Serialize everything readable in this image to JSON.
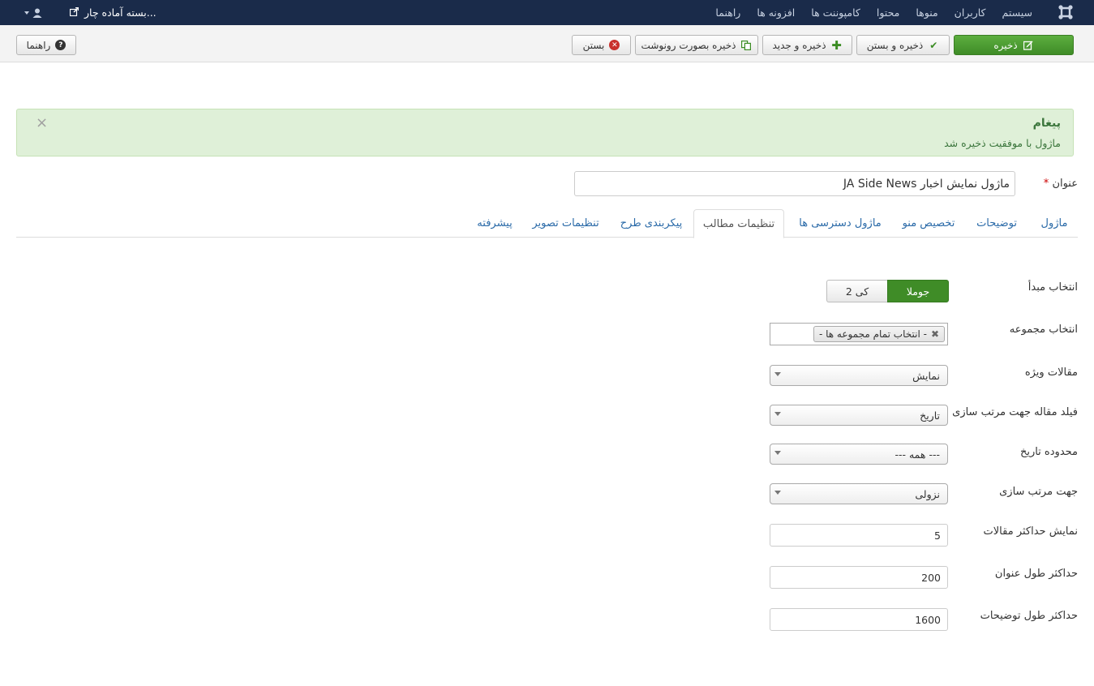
{
  "navbar": {
    "menu": [
      "سیستم",
      "کاربران",
      "منوها",
      "محتوا",
      "کامپوننت ها",
      "افزونه ها",
      "راهنما"
    ],
    "site_link": "بسته آماده چار..."
  },
  "toolbar": {
    "save": "ذخیره",
    "save_close": "ذخیره و بستن",
    "save_new": "ذخیره و جدید",
    "save_copy": "ذخیره بصورت رونوشت",
    "close": "بستن",
    "help": "راهنما"
  },
  "alert": {
    "heading": "پیغام",
    "message": "ماژول با موفقیت ذخیره شد",
    "close": "×"
  },
  "title_field": {
    "label": "عنوان",
    "required_mark": "*",
    "value": "ماژول نمایش اخبار JA Side News"
  },
  "tabs": [
    "ماژول",
    "توضیحات",
    "تخصیص منو",
    "ماژول دسترسی ها",
    "تنظیمات مطالب",
    "پیکربندی طرح",
    "تنظیمات تصویر",
    "پیشرفته"
  ],
  "active_tab": "تنظیمات مطالب",
  "form": {
    "source": {
      "label": "انتخاب مبدأ",
      "options": [
        "جوملا",
        "کی 2"
      ],
      "selected": "جوملا"
    },
    "category": {
      "label": "انتخاب مجموعه",
      "chip": "- انتخاب تمام مجموعه ها -"
    },
    "featured": {
      "label": "مقالات ویژه",
      "value": "نمایش"
    },
    "sort_field": {
      "label": "فیلد مقاله جهت مرتب سازی",
      "value": "تاریخ"
    },
    "date_range": {
      "label": "محدوده تاریخ",
      "value": "--- همه ---"
    },
    "sort_dir": {
      "label": "جهت مرتب سازی",
      "value": "نزولی"
    },
    "max_items": {
      "label": "نمایش حداکثر مقالات",
      "value": "5"
    },
    "max_title": {
      "label": "حداکثر طول عنوان",
      "value": "200"
    },
    "max_desc": {
      "label": "حداکثر طول توضیحات",
      "value": "1600"
    }
  },
  "colors": {
    "navbar": "#1a2b4a",
    "save_button": "#3f8c27",
    "alert_bg": "#dff0d8",
    "link": "#2a6aa8"
  },
  "icons": {
    "logo": "joomla-logo-icon",
    "user": "user-icon",
    "external": "external-link-icon"
  }
}
